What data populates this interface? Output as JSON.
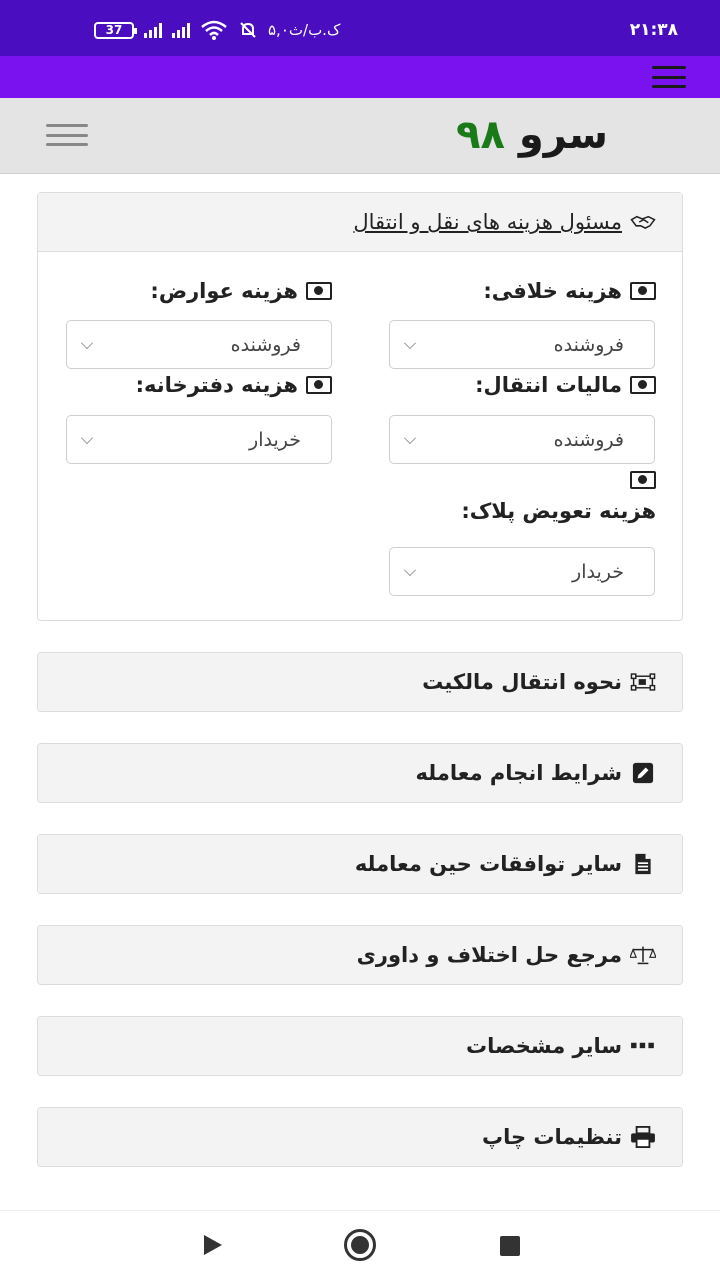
{
  "status": {
    "time": "۲۱:۳۸",
    "battery": "37",
    "net_speed": "۵,۰ک.ب/ث"
  },
  "brand": {
    "name": "سرو",
    "number": "۹۸"
  },
  "costs_card": {
    "title": "مسئول هزینه های نقل و انتقال",
    "fields": {
      "violation": {
        "label": "هزینه خلافی:",
        "value": "فروشنده"
      },
      "duties": {
        "label": "هزینه عوارض:",
        "value": "فروشنده"
      },
      "transfer_tax": {
        "label": "مالیات انتقال:",
        "value": "فروشنده"
      },
      "notary": {
        "label": "هزینه دفترخانه:",
        "value": "خریدار"
      },
      "plate_change": {
        "label": "هزینه تعویض پلاک:",
        "value": "خریدار"
      }
    }
  },
  "sections": [
    {
      "label": "نحوه انتقال مالکیت",
      "icon": "transfer-diagram-icon"
    },
    {
      "label": "شرایط انجام معامله",
      "icon": "edit-icon"
    },
    {
      "label": "سایر توافقات حین معامله",
      "icon": "document-icon"
    },
    {
      "label": "مرجع حل اختلاف و داوری",
      "icon": "scale-icon"
    },
    {
      "label": "سایر مشخصات",
      "icon": "ellipsis-icon"
    },
    {
      "label": "تنظیمات چاپ",
      "icon": "printer-icon"
    }
  ]
}
